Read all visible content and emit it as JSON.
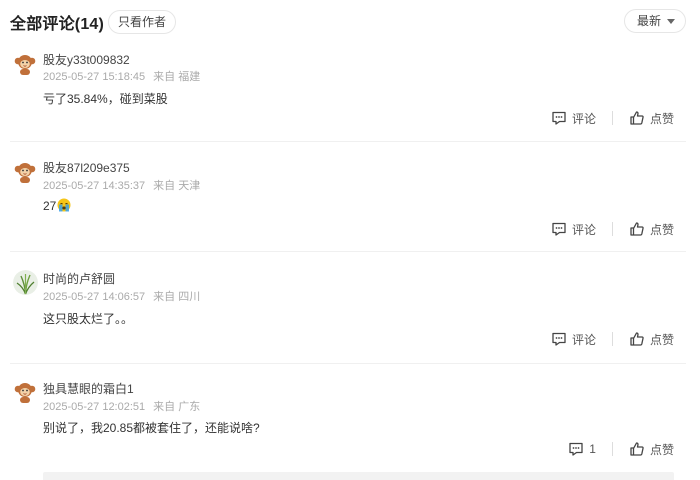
{
  "header": {
    "title": "全部评论(14)",
    "filter_label": "只看作者",
    "sort_label": "最新"
  },
  "comments": [
    {
      "username": "股友y33t009832",
      "time": "2025-05-27 15:18:45",
      "location": "来自 福建",
      "content": "亏了35.84%，碰到菜股",
      "avatar_icon": "monkey-avatar-icon",
      "reply_label": "评论",
      "like_label": "点赞"
    },
    {
      "username": "股友87l209e375",
      "time": "2025-05-27 14:35:37",
      "location": "来自 天津",
      "content": "27",
      "emoji_icon": "crying-face-emoji-icon",
      "avatar_icon": "monkey-avatar-icon",
      "reply_label": "评论",
      "like_label": "点赞"
    },
    {
      "username": "时尚的卢舒圆",
      "time": "2025-05-27 14:06:57",
      "location": "来自 四川",
      "content": "这只股太烂了。。",
      "avatar_icon": "plant-photo-avatar-icon",
      "reply_label": "评论",
      "like_label": "点赞"
    },
    {
      "username": "独具慧眼的霜白1",
      "time": "2025-05-27 12:02:51",
      "location": "来自 广东",
      "content": "别说了，我20.85都被套住了，还能说啥?",
      "avatar_icon": "monkey-avatar-icon",
      "reply_label": "1",
      "like_label": "点赞"
    }
  ],
  "colors": {
    "text_primary": "#333333",
    "text_meta": "#aaaaaa",
    "divider": "#f0f0f0"
  }
}
